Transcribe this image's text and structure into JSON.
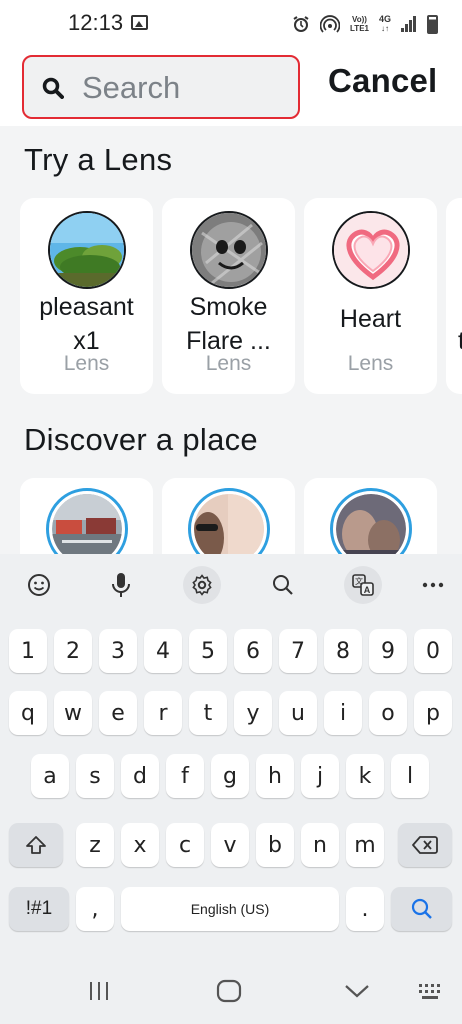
{
  "status_bar": {
    "time": "12:13",
    "volte_line1": "Vo))",
    "volte_line2": "LTE1",
    "network": "4G",
    "icons": [
      "gallery-icon",
      "alarm-icon",
      "hotspot-icon",
      "volte-icon",
      "network-4g-icon",
      "signal-icon",
      "battery-icon"
    ]
  },
  "search": {
    "placeholder": "Search",
    "value": "",
    "cancel_label": "Cancel",
    "highlight_color": "#e32b34"
  },
  "lenses": {
    "title": "Try a Lens",
    "items": [
      {
        "name_line1": "pleasant",
        "name_line2": "x1",
        "type": "Lens",
        "thumb": "tree-sky"
      },
      {
        "name_line1": "Smoke",
        "name_line2": "Flare ...",
        "type": "Lens",
        "thumb": "smoke-face"
      },
      {
        "name_line1": "Heart",
        "name_line2": "",
        "type": "Lens",
        "thumb": "heart"
      },
      {
        "name_line1": "t",
        "name_line2": "",
        "type": "",
        "thumb": ""
      }
    ]
  },
  "places": {
    "title": "Discover a place",
    "items": [
      {
        "thumb": "street-traffic"
      },
      {
        "thumb": "person-sunglasses"
      },
      {
        "thumb": "people-indoor"
      }
    ],
    "ring_color": "#2e9fe0"
  },
  "keyboard": {
    "toolbar": [
      "emoji-icon",
      "microphone-icon",
      "settings-icon",
      "search-icon",
      "translate-icon",
      "more-icon"
    ],
    "row_numbers": [
      "1",
      "2",
      "3",
      "4",
      "5",
      "6",
      "7",
      "8",
      "9",
      "0"
    ],
    "row_1": [
      "q",
      "w",
      "e",
      "r",
      "t",
      "y",
      "u",
      "i",
      "o",
      "p"
    ],
    "row_2": [
      "a",
      "s",
      "d",
      "f",
      "g",
      "h",
      "j",
      "k",
      "l"
    ],
    "row_3": [
      "z",
      "x",
      "c",
      "v",
      "b",
      "n",
      "m"
    ],
    "symbols_label": "!#1",
    "comma": ",",
    "space_label": "English (US)",
    "period": "."
  },
  "nav_bar": {
    "icons": [
      "recent-apps-icon",
      "home-icon",
      "back-icon",
      "keyboard-switch-icon"
    ]
  }
}
